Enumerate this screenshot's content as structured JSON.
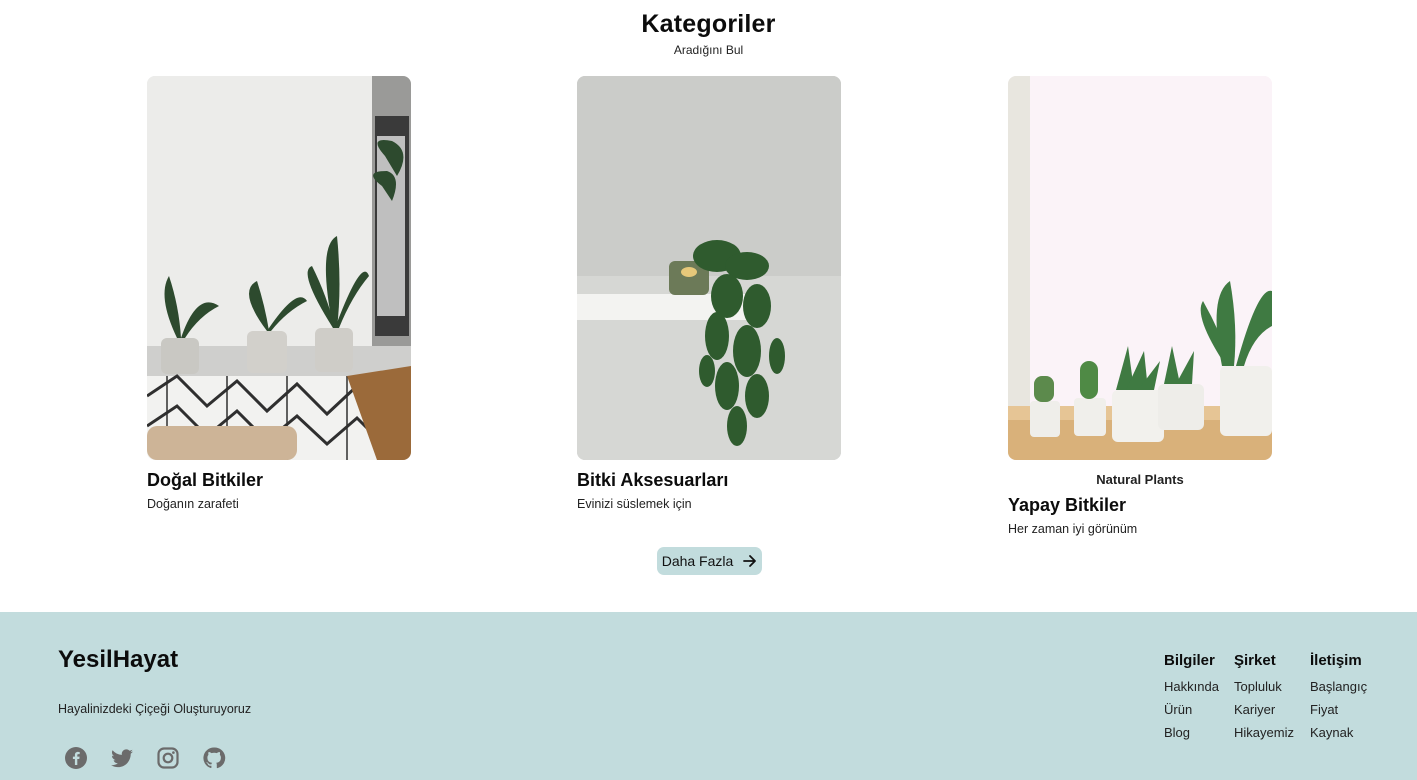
{
  "section": {
    "title": "Kategoriler",
    "subtitle": "Aradığını Bul"
  },
  "cards": [
    {
      "title": "Doğal Bitkiler",
      "desc": "Doğanın zarafeti",
      "image": "living-room-plants-photo"
    },
    {
      "title": "Bitki Aksesuarları",
      "desc": "Evinizi süslemek için",
      "image": "hanging-plant-shelf-photo"
    },
    {
      "tag": "Natural Plants",
      "title": "Yapay Bitkiler",
      "desc": "Her zaman iyi görünüm",
      "image": "windowsill-succulents-photo"
    }
  ],
  "more_button": {
    "label": "Daha Fazla",
    "icon": "arrow-right-icon"
  },
  "footer": {
    "brand": "YesilHayat",
    "tagline": "Hayalinizdeki Çiçeği Oluşturuyoruz",
    "socials": [
      "facebook-icon",
      "twitter-icon",
      "instagram-icon",
      "github-icon"
    ],
    "columns": [
      {
        "heading": "Bilgiler",
        "links": [
          "Hakkında",
          "Ürün",
          "Blog"
        ]
      },
      {
        "heading": "Şirket",
        "links": [
          "Topluluk",
          "Kariyer",
          "Hikayemiz"
        ]
      },
      {
        "heading": "İletişim",
        "links": [
          "Başlangıç",
          "Fiyat",
          "Kaynak"
        ]
      }
    ]
  },
  "colors": {
    "footer_bg": "#c2dcdd",
    "button_bg": "#c2dcdd",
    "text": "#0c0c0c",
    "icon": "#6b6b6b"
  }
}
